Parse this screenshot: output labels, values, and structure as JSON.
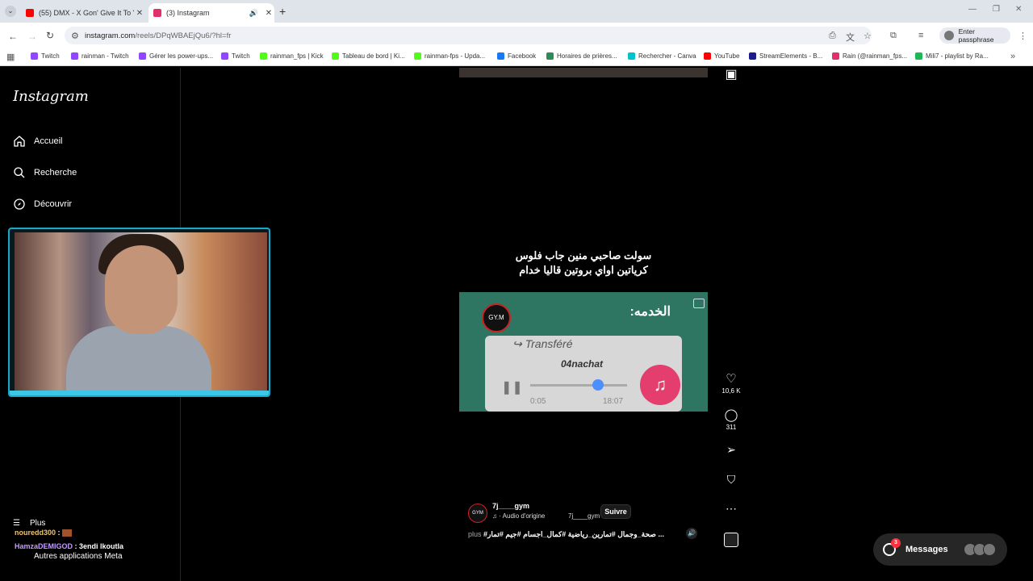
{
  "browser": {
    "tabs": [
      {
        "title": "(55) DMX - X Gon' Give It To Ya",
        "favicon": "youtube-icon",
        "color": "#ff0000"
      },
      {
        "title": "(3) Instagram",
        "favicon": "instagram-icon",
        "color": "#e1306c"
      }
    ],
    "url_main": "instagram.com",
    "url_rest": "/reels/DPqWBAEjQu6/?hl=fr",
    "passphrase": "Enter passphrase",
    "bookmarks": [
      {
        "label": "Twitch",
        "color": "#9146ff"
      },
      {
        "label": "rainman - Twitch",
        "color": "#9146ff"
      },
      {
        "label": "Gérer les power-ups...",
        "color": "#9146ff"
      },
      {
        "label": "Twitch",
        "color": "#9146ff"
      },
      {
        "label": "rainman_fps | Kick",
        "color": "#53fc18"
      },
      {
        "label": "Tableau de bord | Ki...",
        "color": "#53fc18"
      },
      {
        "label": "rainman-fps - Upda...",
        "color": "#53fc18"
      },
      {
        "label": "Facebook",
        "color": "#1877f2"
      },
      {
        "label": "Horaires de prières...",
        "color": "#2e8b57"
      },
      {
        "label": "Rechercher - Canva",
        "color": "#00c4cc"
      },
      {
        "label": "YouTube",
        "color": "#ff0000"
      },
      {
        "label": "StreamElements - B...",
        "color": "#1c1c8c"
      },
      {
        "label": "Rain (@rainman_fps...",
        "color": "#e1306c"
      },
      {
        "label": "Mili7 - playlist by Ra...",
        "color": "#1db954"
      }
    ]
  },
  "sidebar": {
    "logo": "Instagram",
    "items": [
      {
        "label": "Accueil",
        "icon": "home-icon"
      },
      {
        "label": "Recherche",
        "icon": "search-icon"
      },
      {
        "label": "Découvrir",
        "icon": "compass-icon"
      }
    ],
    "more": "Plus",
    "meta": "Autres applications Meta"
  },
  "chat": [
    {
      "user": "nouredd300",
      "sep": " :",
      "msg": ""
    },
    {
      "user": "HamzaDEMIGOD",
      "sep": " :",
      "msg": " 3endi lkoutla"
    }
  ],
  "reel": {
    "caption_line1": "سولت صاحبي منين جاب فلوس",
    "caption_line2": "كرياتين اواي بروتين قاليا خدام",
    "video_title": "الخدمه:",
    "video_badge": "GY.M",
    "forwarded": "Transféré",
    "audio_name": "04nachat",
    "time_start": "0:05",
    "time_end": "18:07",
    "progress": 0.7,
    "likes": "10,6 K",
    "comments": "311",
    "author": "7j____gym",
    "audio_label": "· Audio d'origine",
    "audio_tag": "7j____gym",
    "follow": "Suivre",
    "hashtags": "#صحة_وجمال #تمارين_رياضية #كمال_اجسام #جيم #تمار ...",
    "more": "plus"
  },
  "messages": {
    "label": "Messages",
    "badge": "3"
  }
}
